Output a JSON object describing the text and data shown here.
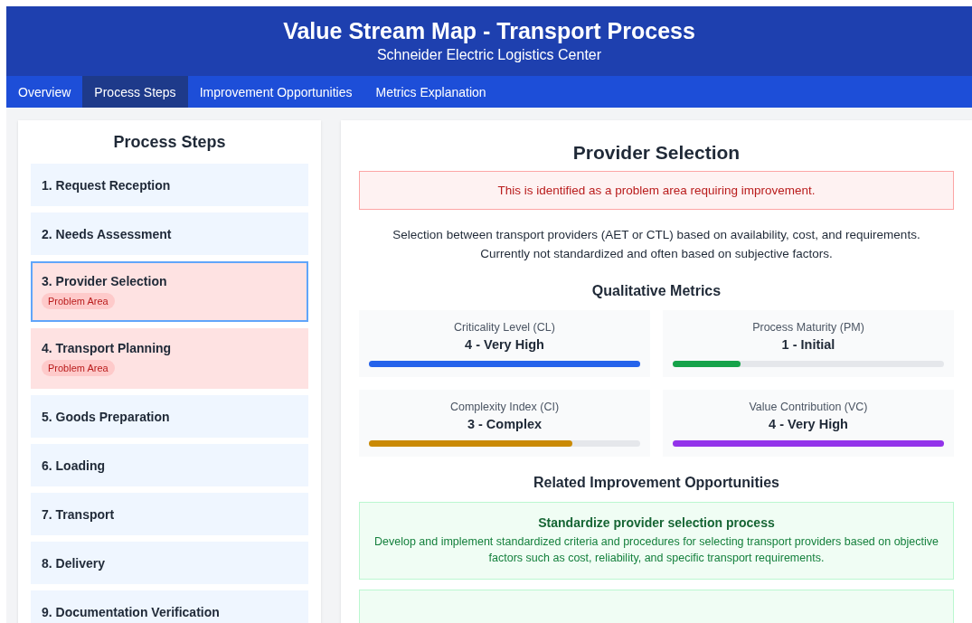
{
  "header": {
    "title": "Value Stream Map - Transport Process",
    "subtitle": "Schneider Electric Logistics Center"
  },
  "tabs": [
    {
      "label": "Overview",
      "selected": false
    },
    {
      "label": "Process Steps",
      "selected": true
    },
    {
      "label": "Improvement Opportunities",
      "selected": false
    },
    {
      "label": "Metrics Explanation",
      "selected": false
    }
  ],
  "sidebar": {
    "title": "Process Steps",
    "items": [
      {
        "label": "1. Request Reception",
        "selected": false,
        "problem": false
      },
      {
        "label": "2. Needs Assessment",
        "selected": false,
        "problem": false
      },
      {
        "label": "3. Provider Selection",
        "selected": true,
        "problem": true,
        "badge": "Problem Area"
      },
      {
        "label": "4. Transport Planning",
        "selected": false,
        "problem": true,
        "badge": "Problem Area"
      },
      {
        "label": "5. Goods Preparation",
        "selected": false,
        "problem": false
      },
      {
        "label": "6. Loading",
        "selected": false,
        "problem": false
      },
      {
        "label": "7. Transport",
        "selected": false,
        "problem": false
      },
      {
        "label": "8. Delivery",
        "selected": false,
        "problem": false
      },
      {
        "label": "9. Documentation Verification",
        "selected": false,
        "problem": false
      }
    ]
  },
  "detail": {
    "title": "Provider Selection",
    "alert": "This is identified as a problem area requiring improvement.",
    "description": "Selection between transport providers (AET or CTL) based on availability, cost, and requirements. Currently not standardized and often based on subjective factors.",
    "metrics_title": "Qualitative Metrics",
    "metrics": [
      {
        "name": "Criticality Level (CL)",
        "value": "4 - Very High",
        "level": 1.0,
        "color": "#2563eb"
      },
      {
        "name": "Process Maturity (PM)",
        "value": "1 - Initial",
        "level": 0.25,
        "color": "#16a34a"
      },
      {
        "name": "Complexity Index (CI)",
        "value": "3 - Complex",
        "level": 0.75,
        "color": "#ca8a04"
      },
      {
        "name": "Value Contribution (VC)",
        "value": "4 - Very High",
        "level": 1.0,
        "color": "#9333ea"
      }
    ],
    "opportunities_title": "Related Improvement Opportunities",
    "opportunities": [
      {
        "title": "Standardize provider selection process",
        "text": "Develop and implement standardized criteria and procedures for selecting transport providers based on objective factors such as cost, reliability, and specific transport requirements."
      },
      {
        "kind": "cut"
      }
    ]
  }
}
